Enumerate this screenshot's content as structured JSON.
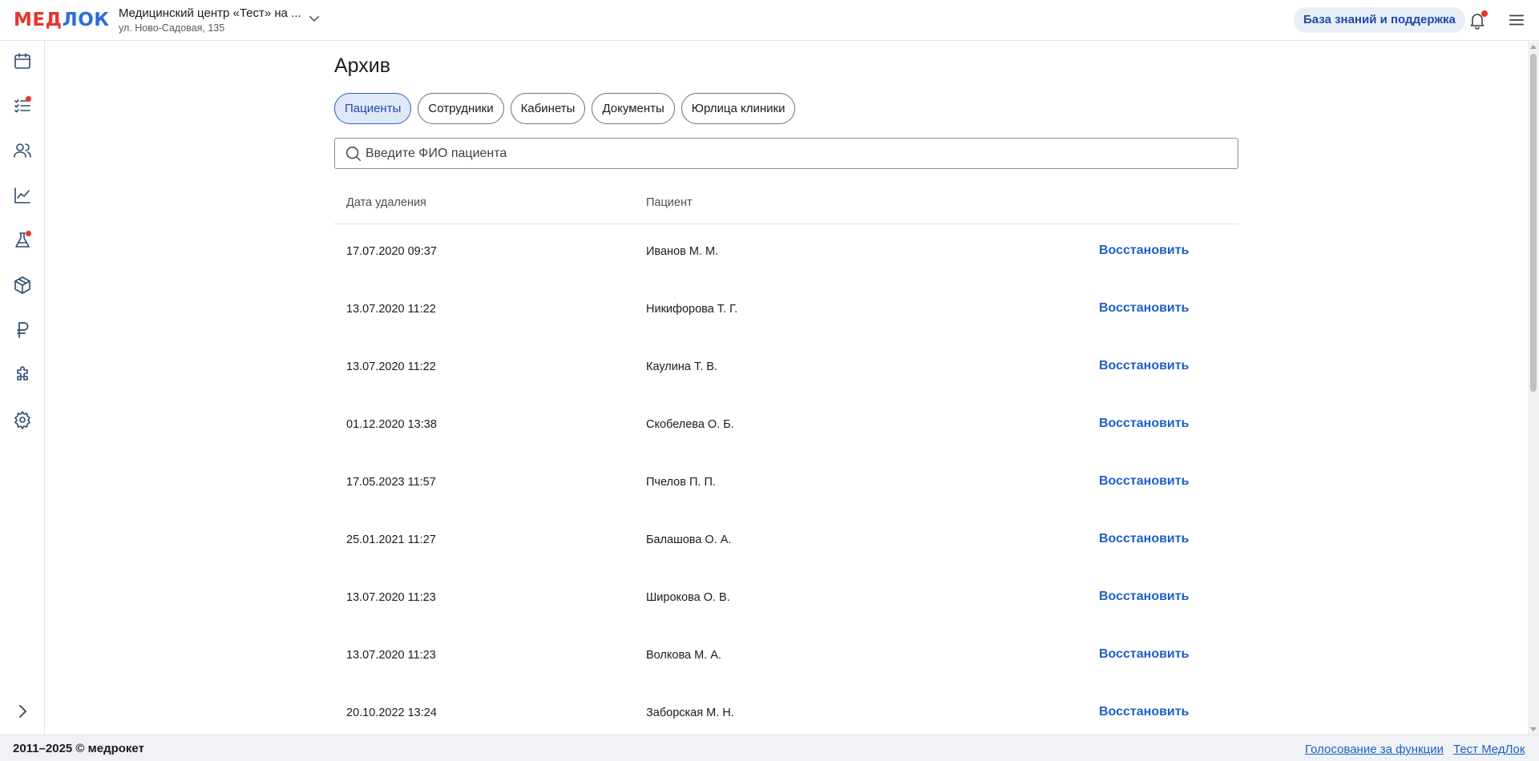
{
  "header": {
    "logo": {
      "part1": "МЕД",
      "part2": "ЛОК"
    },
    "clinic_name": "Медицинский центр «Тест» на ...",
    "clinic_address": "ул. Ново-Садовая, 135",
    "kb_button": "База знаний и поддержка",
    "icons": [
      "chevron-down-icon",
      "bell-icon",
      "menu-icon"
    ]
  },
  "sidebar": {
    "items": [
      {
        "name": "calendar-icon",
        "badge": false
      },
      {
        "name": "tasks-icon",
        "badge": true
      },
      {
        "name": "users-icon",
        "badge": false
      },
      {
        "name": "analytics-icon",
        "badge": false
      },
      {
        "name": "lab-flask-icon",
        "badge": true
      },
      {
        "name": "warehouse-box-icon",
        "badge": false
      },
      {
        "name": "finance-ruble-icon",
        "badge": false
      },
      {
        "name": "integrations-puzzle-icon",
        "badge": false
      },
      {
        "name": "settings-gear-icon",
        "badge": false
      }
    ],
    "expand_icon": "chevron-right-icon"
  },
  "main": {
    "title": "Архив",
    "tabs": [
      {
        "label": "Пациенты",
        "active": true
      },
      {
        "label": "Сотрудники",
        "active": false
      },
      {
        "label": "Кабинеты",
        "active": false
      },
      {
        "label": "Документы",
        "active": false
      },
      {
        "label": "Юрлица клиники",
        "active": false
      }
    ],
    "search": {
      "placeholder": "Введите ФИО пациента",
      "value": ""
    },
    "table": {
      "columns": [
        "Дата удаления",
        "Пациент"
      ],
      "action_label": "Восстановить",
      "rows": [
        {
          "date": "17.07.2020 09:37",
          "patient": "Иванов М. М."
        },
        {
          "date": "13.07.2020 11:22",
          "patient": "Никифорова Т. Г."
        },
        {
          "date": "13.07.2020 11:22",
          "patient": "Каулина Т. В."
        },
        {
          "date": "01.12.2020 13:38",
          "patient": "Скобелева О. Б."
        },
        {
          "date": "17.05.2023 11:57",
          "patient": "Пчелов П. П."
        },
        {
          "date": "25.01.2021 11:27",
          "patient": "Балашова О. А."
        },
        {
          "date": "13.07.2020 11:23",
          "patient": "Широкова О. В."
        },
        {
          "date": "13.07.2020 11:23",
          "patient": "Волкова М. А."
        },
        {
          "date": "20.10.2022 13:24",
          "patient": "Заборская М. Н."
        }
      ]
    }
  },
  "footer": {
    "copyright": "2011–2025 © медрокет",
    "links": [
      "Голосование за функции",
      "Тест МедЛок"
    ]
  },
  "colors": {
    "accent": "#1f5fc8",
    "brand_red": "#e8342e",
    "brand_blue": "#2b6fd6",
    "active_tab_bg": "#dfe8f7"
  }
}
